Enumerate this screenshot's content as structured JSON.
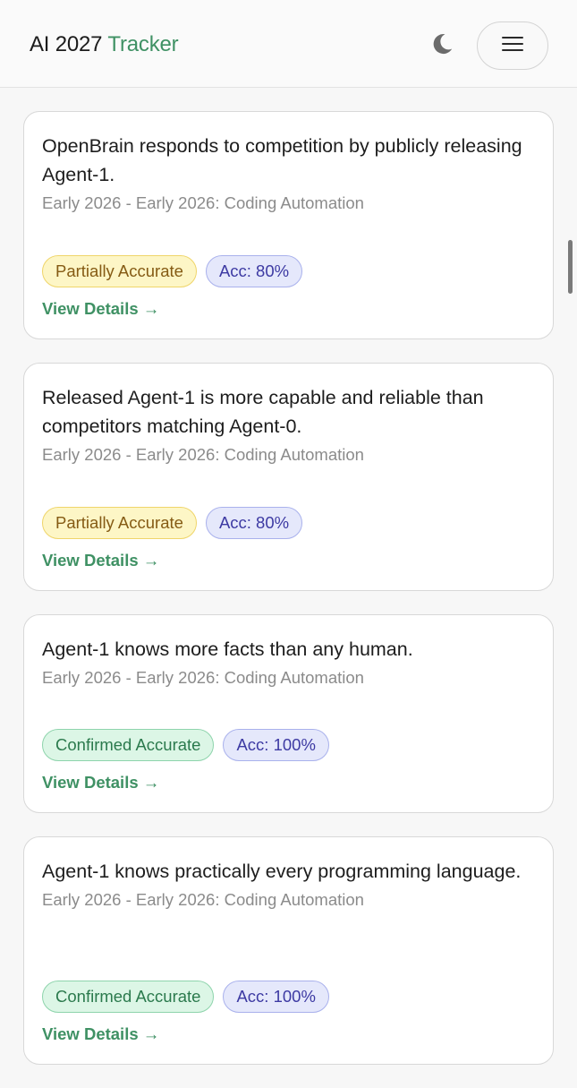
{
  "header": {
    "brand_main": "AI 2027",
    "brand_accent": "Tracker",
    "theme_icon": "moon-icon",
    "menu_icon": "hamburger-menu-icon"
  },
  "colors": {
    "accent": "#3f9164",
    "partial": "#855b14",
    "confirmed": "#2b7a4d",
    "accuracy": "#3d3aa3"
  },
  "predictions": [
    {
      "title": "OpenBrain responds to competition by publicly releasing Agent-1.",
      "meta": "Early 2026 - Early 2026: Coding Automation",
      "status": "Partially Accurate",
      "accuracy": "Acc: 80%",
      "link": "View Details →"
    },
    {
      "title": "Released Agent-1 is more capable and reliable than competitors matching Agent-0.",
      "meta": "Early 2026 - Early 2026: Coding Automation",
      "status": "Partially Accurate",
      "accuracy": "Acc: 80%",
      "link": "View Details →"
    },
    {
      "title": "Agent-1 knows more facts than any human.",
      "meta": "Early 2026 - Early 2026: Coding Automation",
      "status": "Confirmed Accurate",
      "accuracy": "Acc: 100%",
      "link": "View Details →"
    },
    {
      "title": "Agent-1 knows practically every programming language.",
      "meta": "Early 2026 - Early 2026: Coding Automation",
      "status": "Confirmed Accurate",
      "accuracy": "Acc: 100%",
      "link": "View Details →"
    }
  ]
}
